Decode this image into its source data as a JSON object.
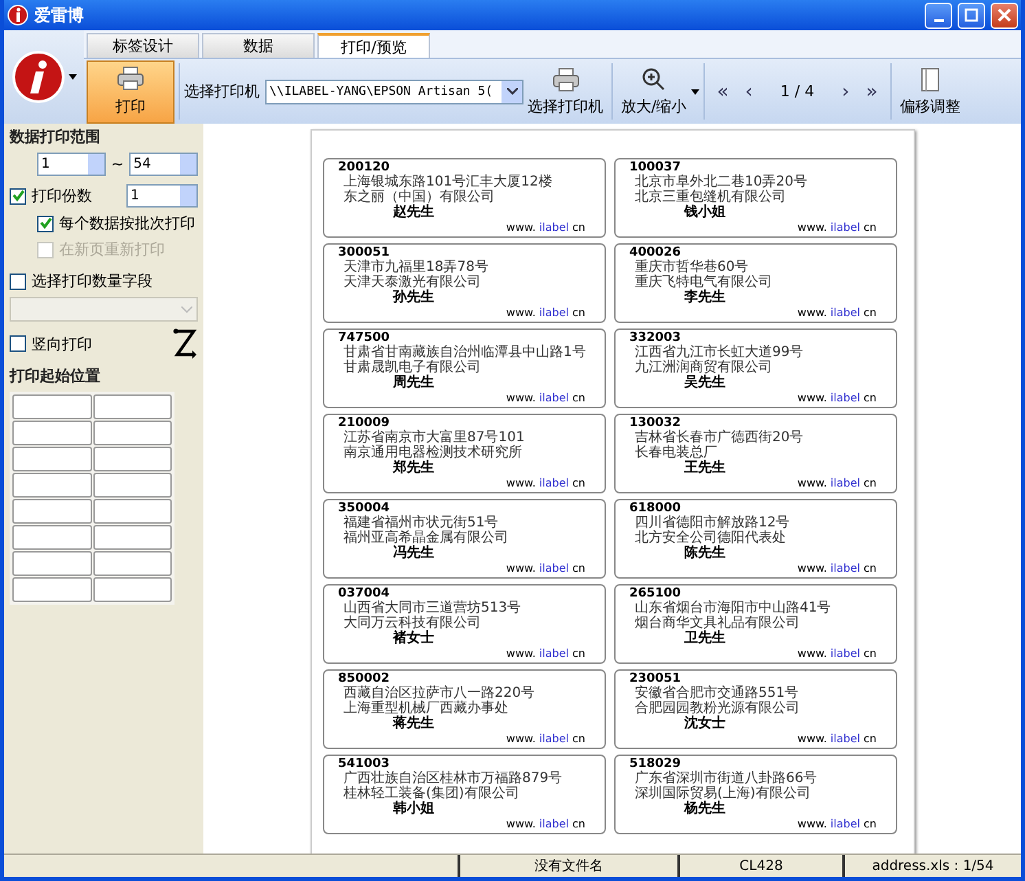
{
  "window": {
    "title": "爱雷博"
  },
  "tabs": [
    {
      "label": "标签设计",
      "selected": false
    },
    {
      "label": "数据",
      "selected": false
    },
    {
      "label": "打印/预览",
      "selected": true
    }
  ],
  "toolbar": {
    "print_button": "打印",
    "printer_label": "选择打印机",
    "printer_value": "\\\\ILABEL-YANG\\EPSON Artisan 5(",
    "select_printer_button": "选择打印机",
    "zoom_button": "放大/缩小",
    "first_page": "«",
    "prev_page": "‹",
    "page_indicator": "1 / 4",
    "next_page": "›",
    "last_page": "»",
    "offset_button": "偏移调整"
  },
  "left_panel": {
    "range_title": "数据打印范围",
    "range_from": "1",
    "range_separator": "~",
    "range_to": "54",
    "checks": [
      {
        "label": "打印份数",
        "checked": true,
        "disabled": false,
        "children": [
          {
            "label": "每个数据按批次打印",
            "checked": true,
            "disabled": false
          },
          {
            "label": "在新页重新打印",
            "checked": false,
            "disabled": true
          }
        ]
      },
      {
        "label": "选择打印数量字段",
        "checked": false,
        "disabled": false
      }
    ],
    "copies": "1",
    "vertical_print": {
      "label": "竖向打印",
      "checked": false
    },
    "start_title": "打印起始位置",
    "start_cells": [
      {
        "selected": false
      },
      {
        "selected": false
      },
      {
        "selected": false
      },
      {
        "selected": false
      },
      {
        "selected": false
      },
      {
        "selected": false
      },
      {
        "selected": false
      },
      {
        "selected": false
      },
      {
        "selected": false
      },
      {
        "selected": false
      },
      {
        "selected": false
      },
      {
        "selected": false
      },
      {
        "selected": false
      },
      {
        "selected": false
      },
      {
        "selected": false
      },
      {
        "selected": false
      }
    ]
  },
  "labels": [
    {
      "code": "200120",
      "address": "上海银城东路101号汇丰大厦12楼",
      "company": "东之丽（中国）有限公司",
      "name": "赵先生",
      "url_start": "www.",
      "url_brand": "ilabel",
      "url_end": "cn"
    },
    {
      "code": "100037",
      "address": "北京市阜外北二巷10弄20号",
      "company": "北京三重包缝机有限公司",
      "name": "钱小姐",
      "url_start": "www.",
      "url_brand": "ilabel",
      "url_end": "cn"
    },
    {
      "code": "300051",
      "address": "天津市九福里18弄78号",
      "company": "天津天泰激光有限公司",
      "name": "孙先生",
      "url_start": "www.",
      "url_brand": "ilabel",
      "url_end": "cn"
    },
    {
      "code": "400026",
      "address": "重庆市哲华巷60号",
      "company": "重庆飞特电气有限公司",
      "name": "李先生",
      "url_start": "www.",
      "url_brand": "ilabel",
      "url_end": "cn"
    },
    {
      "code": "747500",
      "address": "甘肃省甘南藏族自治州临潭县中山路1号",
      "company": "甘肃晟凯电子有限公司",
      "name": "周先生",
      "url_start": "www.",
      "url_brand": "ilabel",
      "url_end": "cn"
    },
    {
      "code": "332003",
      "address": "江西省九江市长虹大道99号",
      "company": "九江洲润商贸有限公司",
      "name": "吴先生",
      "url_start": "www.",
      "url_brand": "ilabel",
      "url_end": "cn"
    },
    {
      "code": "210009",
      "address": "江苏省南京市大富里87号101",
      "company": "南京通用电器检测技术研究所",
      "name": "郑先生",
      "url_start": "www.",
      "url_brand": "ilabel",
      "url_end": "cn"
    },
    {
      "code": "130032",
      "address": "吉林省长春市广德西街20号",
      "company": "长春电装总厂",
      "name": "王先生",
      "url_start": "www.",
      "url_brand": "ilabel",
      "url_end": "cn"
    },
    {
      "code": "350004",
      "address": "福建省福州市状元街51号",
      "company": "福州亚高希晶金属有限公司",
      "name": "冯先生",
      "url_start": "www.",
      "url_brand": "ilabel",
      "url_end": "cn"
    },
    {
      "code": "618000",
      "address": "四川省德阳市解放路12号",
      "company": "北方安全公司德阳代表处",
      "name": "陈先生",
      "url_start": "www.",
      "url_brand": "ilabel",
      "url_end": "cn"
    },
    {
      "code": "037004",
      "address": "山西省大同市三道营坊513号",
      "company": "大同万云科技有限公司",
      "name": "褚女士",
      "url_start": "www.",
      "url_brand": "ilabel",
      "url_end": "cn"
    },
    {
      "code": "265100",
      "address": "山东省烟台市海阳市中山路41号",
      "company": "烟台商华文具礼品有限公司",
      "name": "卫先生",
      "url_start": "www.",
      "url_brand": "ilabel",
      "url_end": "cn"
    },
    {
      "code": "850002",
      "address": "西藏自治区拉萨市八一路220号",
      "company": "上海重型机械厂西藏办事处",
      "name": "蒋先生",
      "url_start": "www.",
      "url_brand": "ilabel",
      "url_end": "cn"
    },
    {
      "code": "230051",
      "address": "安徽省合肥市交通路551号",
      "company": "合肥园园教粉光源有限公司",
      "name": "沈女士",
      "url_start": "www.",
      "url_brand": "ilabel",
      "url_end": "cn"
    },
    {
      "code": "541003",
      "address": "广西壮族自治区桂林市万福路879号",
      "company": "桂林轻工装备(集团)有限公司",
      "name": "韩小姐",
      "url_start": "www.",
      "url_brand": "ilabel",
      "url_end": "cn"
    },
    {
      "code": "518029",
      "address": "广东省深圳市街道八卦路66号",
      "company": "深圳国际贸易(上海)有限公司",
      "name": "杨先生",
      "url_start": "www.",
      "url_brand": "ilabel",
      "url_end": "cn"
    }
  ],
  "status_bar": [
    "没有文件名",
    "CL428",
    "address.xls : 1/54"
  ]
}
